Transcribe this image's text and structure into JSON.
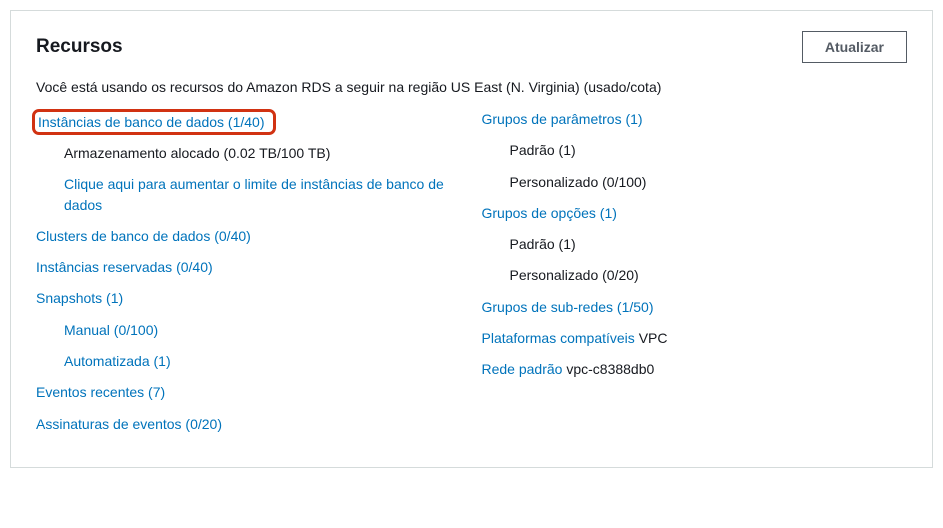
{
  "header": {
    "title": "Recursos",
    "update_button": "Atualizar"
  },
  "description": "Você está usando os recursos do Amazon RDS a seguir na região US East (N. Virginia) (usado/cota)",
  "left": {
    "db_instances": "Instâncias de banco de dados (1/40)",
    "allocated_storage": "Armazenamento alocado (0.02 TB/100 TB)",
    "increase_limit": "Clique aqui para aumentar o limite de instâncias de banco de dados",
    "db_clusters": "Clusters de banco de dados (0/40)",
    "reserved_instances": "Instâncias reservadas (0/40)",
    "snapshots": "Snapshots (1)",
    "manual": "Manual (0/100)",
    "automated": "Automatizada (1)",
    "recent_events": "Eventos recentes (7)",
    "event_subscriptions": "Assinaturas de eventos (0/20)"
  },
  "right": {
    "parameter_groups": "Grupos de parâmetros (1)",
    "param_default": "Padrão (1)",
    "param_custom": "Personalizado (0/100)",
    "option_groups": "Grupos de opções (1)",
    "option_default": "Padrão (1)",
    "option_custom": "Personalizado (0/20)",
    "subnet_groups": "Grupos de sub-redes (1/50)",
    "supported_platforms_label": "Plataformas compatíveis",
    "supported_platforms_value": "VPC",
    "default_network_label": "Rede padrão",
    "default_network_value": "vpc-c8388db0"
  }
}
